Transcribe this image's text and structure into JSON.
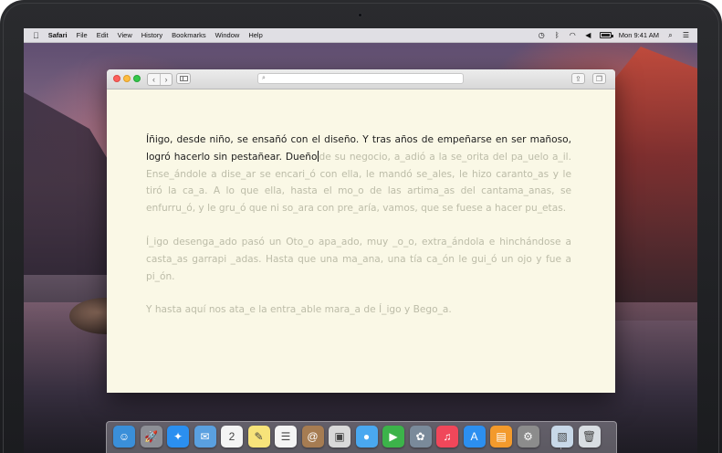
{
  "menubar": {
    "apple": "",
    "items": [
      "Safari",
      "File",
      "Edit",
      "View",
      "History",
      "Bookmarks",
      "Window",
      "Help"
    ],
    "clock": "Mon 9:41 AM",
    "battery_level": 0.85
  },
  "window": {
    "address_placeholder": "",
    "icons": {
      "back": "chevron-left-icon",
      "forward": "chevron-right-icon",
      "sidebar": "sidebar-icon",
      "search": "search-icon",
      "share": "share-icon",
      "tabs": "tabs-icon"
    }
  },
  "document": {
    "p1_typed": "Íñigo, desde niño, se ensañó con el diseño. Y tras años de empeñarse en ser mañoso, logró hacerlo sin pestañear. Dueño",
    "p1_faded": "de su negocio, a_adió a la se_orita del pa_uelo a_il. Ense_ándole a dise_ar se encari_ó con ella, le mandó se_ales, le hizo caranto_as y le tiró la ca_a. A lo que ella, hasta el mo_o de las artima_as del cantama_anas, se enfurru_ó, y le gru_ó que ni so_ara con pre_aría, vamos, que se fuese a hacer pu_etas.",
    "p2": "Í_igo desenga_ado pasó un Oto_o apa_ado, muy _o_o, extra_ándola e hinchándose a casta_as garrapi _adas. Hasta que una ma_ana, una tía ca_ón le gui_ó un ojo y fue a pi_ón.",
    "p3": "Y hasta aquí nos ata_e la entra_able mara_a de Í_igo y Bego_a."
  },
  "dock": {
    "apps": [
      {
        "name": "finder-icon",
        "glyph": "☺",
        "color": "#3a8fd9"
      },
      {
        "name": "launchpad-icon",
        "glyph": "🚀",
        "color": "#8d8f96"
      },
      {
        "name": "safari-icon",
        "glyph": "✦",
        "color": "#2b8ff0"
      },
      {
        "name": "mail-icon",
        "glyph": "✉",
        "color": "#5aa0e0"
      },
      {
        "name": "calendar-icon",
        "glyph": "2",
        "color": "#f4f4f4"
      },
      {
        "name": "notes-icon",
        "glyph": "✎",
        "color": "#f7e37a"
      },
      {
        "name": "reminders-icon",
        "glyph": "☰",
        "color": "#f4f4f4"
      },
      {
        "name": "contacts-icon",
        "glyph": "@",
        "color": "#a67c52"
      },
      {
        "name": "photo-booth-icon",
        "glyph": "▣",
        "color": "#d9d9d9"
      },
      {
        "name": "messages-icon",
        "glyph": "●",
        "color": "#4aa8f0"
      },
      {
        "name": "facetime-icon",
        "glyph": "▶",
        "color": "#3cb34a"
      },
      {
        "name": "photos-icon",
        "glyph": "✿",
        "color": "#7a8a9a"
      },
      {
        "name": "music-icon",
        "glyph": "♫",
        "color": "#f0475a"
      },
      {
        "name": "app-store-icon",
        "glyph": "A",
        "color": "#2c8ff0"
      },
      {
        "name": "ibooks-icon",
        "glyph": "▤",
        "color": "#f39a2c"
      },
      {
        "name": "system-preferences-icon",
        "glyph": "⚙",
        "color": "#8c8c8c"
      },
      {
        "name": "preview-icon",
        "glyph": "▧",
        "color": "#c8d8e8"
      },
      {
        "name": "trash-icon",
        "glyph": "🗑",
        "color": "#d8dde2"
      }
    ]
  }
}
